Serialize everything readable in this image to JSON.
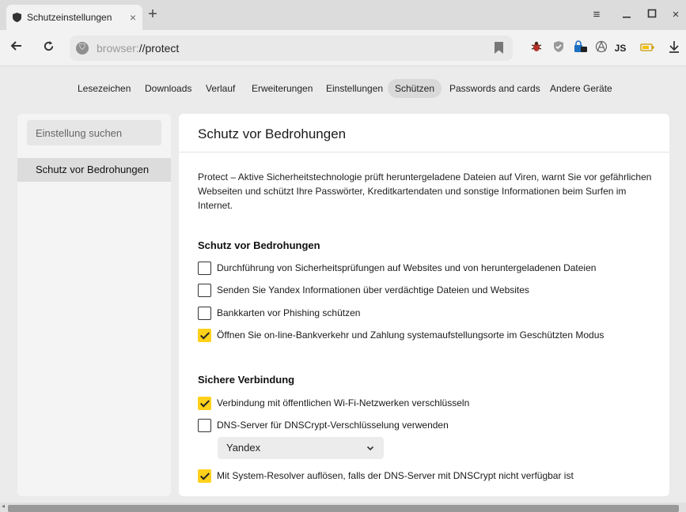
{
  "tab": {
    "title": "Schutzeinstellungen",
    "close": "×",
    "new_tab": "+"
  },
  "window": {
    "menu": "≡",
    "minimize": "—",
    "maximize": "□",
    "close": "×"
  },
  "address": {
    "scheme": "browser:",
    "path": "//protect"
  },
  "extensions": {
    "js_label": "JS"
  },
  "settings_nav": [
    {
      "label": "Lesezeichen"
    },
    {
      "label": "Downloads"
    },
    {
      "label": "Verlauf"
    },
    {
      "label": "Erweiterungen"
    },
    {
      "label": "Einstellungen"
    },
    {
      "label": "Schützen",
      "active": true
    },
    {
      "label": "Passwords and cards"
    },
    {
      "label": "Andere Geräte"
    }
  ],
  "sidebar": {
    "search_placeholder": "Einstellung suchen",
    "items": [
      {
        "label": "Schutz vor Bedrohungen",
        "selected": true
      }
    ]
  },
  "main": {
    "title": "Schutz vor Bedrohungen",
    "description": "Protect – Aktive Sicherheitstechnologie prüft heruntergeladene Dateien auf Viren, warnt Sie vor gefährlichen Webseiten und schützt Ihre Passwörter, Kreditkartendaten und sonstige Informationen beim Surfen im Internet.",
    "sections": [
      {
        "title": "Schutz vor Bedrohungen",
        "options": [
          {
            "label": "Durchführung von Sicherheitsprüfungen auf Websites und von heruntergeladenen Dateien",
            "checked": false
          },
          {
            "label": "Senden Sie Yandex Informationen über verdächtige Dateien und Websites",
            "checked": false
          },
          {
            "label": "Bankkarten vor Phishing schützen",
            "checked": false
          },
          {
            "label": "Öffnen Sie on-line-Bankverkehr und Zahlung systemaufstellungsorte im Geschützten Modus",
            "checked": true
          }
        ]
      },
      {
        "title": "Sichere Verbindung",
        "options": [
          {
            "label": "Verbindung mit öffentlichen Wi-Fi-Netzwerken verschlüsseln",
            "checked": true
          },
          {
            "label": "DNS-Server für DNSCrypt-Verschlüsselung verwenden",
            "checked": false
          },
          {
            "label": "Mit System-Resolver auflösen, falls der DNS-Server mit DNSCrypt nicht verfügbar ist",
            "checked": true
          }
        ],
        "dns_select": {
          "value": "Yandex"
        }
      }
    ]
  },
  "colors": {
    "accent": "#ffd11a",
    "sidebar_selected": "#dcdcdc",
    "page_bg": "#ebebeb"
  }
}
